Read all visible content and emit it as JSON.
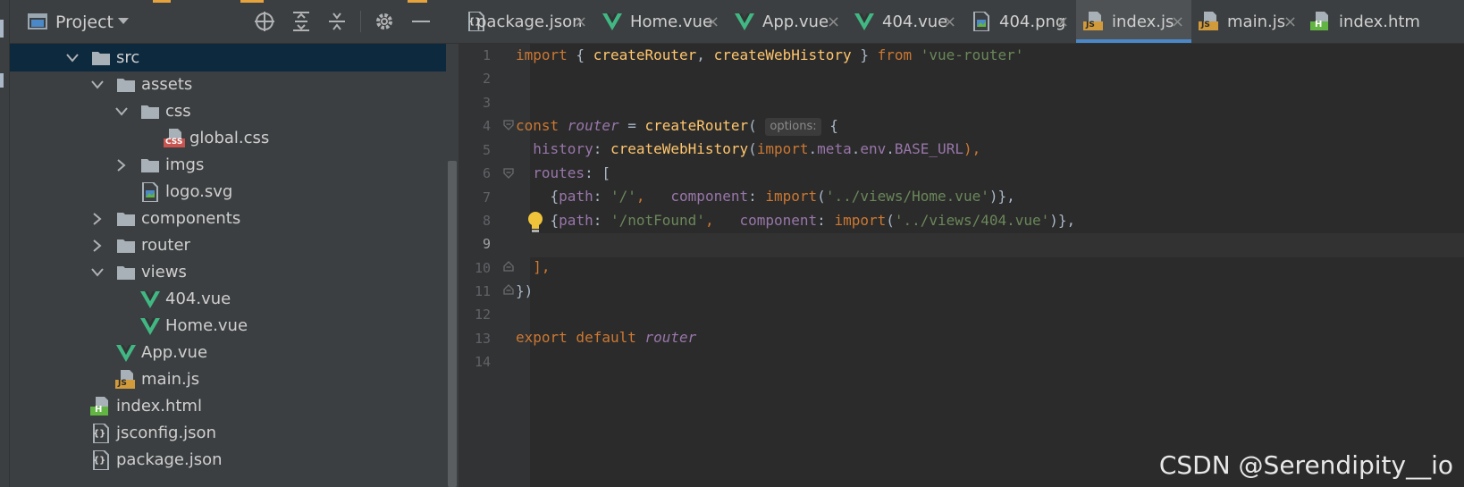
{
  "colors": {
    "accent": "#4a88c7",
    "vue_green": "#41b883",
    "keyword": "#cc7832",
    "function": "#ffc66d",
    "string": "#6a8759",
    "property": "#9876aa"
  },
  "project_panel": {
    "title": "Project",
    "toolbar_icons": [
      "crosshair-icon",
      "expand-all-icon",
      "collapse-all-icon",
      "gear-icon",
      "minimize-icon"
    ],
    "tree": [
      {
        "label": "src",
        "type": "folder",
        "expanded": true,
        "selected": true
      },
      {
        "label": "assets",
        "type": "folder",
        "expanded": true
      },
      {
        "label": "css",
        "type": "folder",
        "expanded": true
      },
      {
        "label": "global.css",
        "type": "css-file"
      },
      {
        "label": "imgs",
        "type": "folder",
        "expanded": false
      },
      {
        "label": "logo.svg",
        "type": "image-file"
      },
      {
        "label": "components",
        "type": "folder",
        "expanded": false
      },
      {
        "label": "router",
        "type": "folder",
        "expanded": false
      },
      {
        "label": "views",
        "type": "folder",
        "expanded": true
      },
      {
        "label": "404.vue",
        "type": "vue-file"
      },
      {
        "label": "Home.vue",
        "type": "vue-file"
      },
      {
        "label": "App.vue",
        "type": "vue-file"
      },
      {
        "label": "main.js",
        "type": "js-file"
      },
      {
        "label": "index.html",
        "type": "html-file"
      },
      {
        "label": "jsconfig.json",
        "type": "json-file"
      },
      {
        "label": "package.json",
        "type": "json-file"
      }
    ]
  },
  "tabs": [
    {
      "label": "package.json",
      "icon": "json-file-icon"
    },
    {
      "label": "Home.vue",
      "icon": "vue-icon"
    },
    {
      "label": "App.vue",
      "icon": "vue-icon"
    },
    {
      "label": "404.vue",
      "icon": "vue-icon"
    },
    {
      "label": "404.png",
      "icon": "image-file-icon"
    },
    {
      "label": "index.js",
      "icon": "js-file-icon",
      "active": true
    },
    {
      "label": "main.js",
      "icon": "js-file-icon"
    },
    {
      "label": "index.htm",
      "icon": "html-file-icon"
    }
  ],
  "tab_close_glyph": "×",
  "file_badges": {
    "css": "CSS",
    "js": "JS",
    "html": "H",
    "json": "{}"
  },
  "editor": {
    "line_numbers": [
      "1",
      "2",
      "3",
      "4",
      "5",
      "6",
      "7",
      "8",
      "9",
      "10",
      "11",
      "12",
      "13",
      "14"
    ],
    "current_line": 9,
    "param_hint": "options:",
    "code": {
      "l1": {
        "kw1": "import",
        "p1": " { ",
        "fn1": "createRouter",
        "p2": ", ",
        "fn2": "createWebHistory",
        "p3": " } ",
        "kw2": "from",
        "p4": " ",
        "str1": "'vue-router'"
      },
      "l4": {
        "kw1": "const ",
        "var1": "router",
        "p1": " = ",
        "fn1": "createRouter",
        "p2": "( ",
        "p3": " {"
      },
      "l5": {
        "prop1": "  history",
        "p1": ": ",
        "fn1": "createWebHistory",
        "p2": "(",
        "kw1": "import",
        "p3": ".",
        "prop2": "meta",
        "p4": ".",
        "prop3": "env",
        "p5": ".",
        "prop4": "BASE_URL",
        "p6": "),"
      },
      "l6": {
        "prop1": "  routes",
        "p1": ": ["
      },
      "l7": {
        "p1": "    {",
        "prop1": "path",
        "p2": ": ",
        "str1": "'/'",
        "p3": ",   ",
        "prop2": "component",
        "p4": ": ",
        "kw1": "import",
        "p5": "(",
        "str2": "'../views/Home.vue'",
        "p6": ")},"
      },
      "l8": {
        "p1": "    {",
        "prop1": "path",
        "p2": ": ",
        "str1": "'/notFound'",
        "p3": ",   ",
        "prop2": "component",
        "p4": ": ",
        "kw1": "import",
        "p5": "(",
        "str2": "'../views/404.vue'",
        "p6": ")},"
      },
      "l10": {
        "p1": "  ],"
      },
      "l11": {
        "p1": "})"
      },
      "l13": {
        "kw1": "export default ",
        "var1": "router"
      }
    }
  },
  "watermark": "CSDN @Serendipity__io"
}
